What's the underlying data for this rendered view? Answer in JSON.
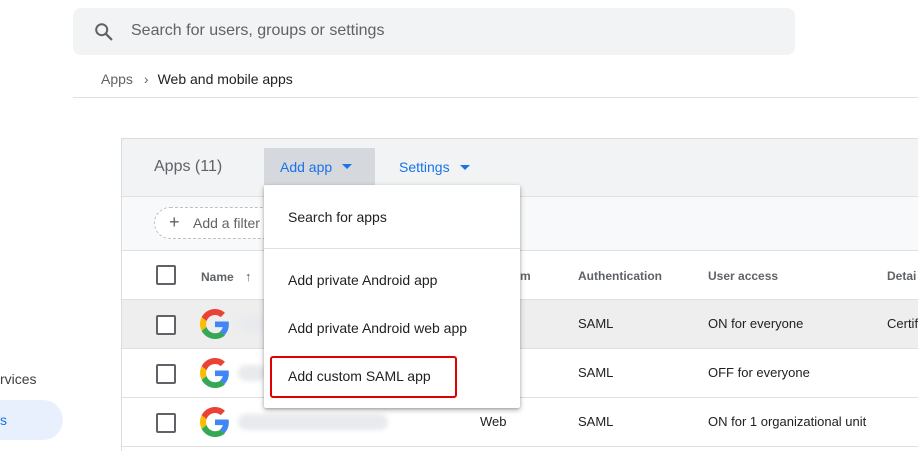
{
  "search": {
    "placeholder": "Search for users, groups or settings"
  },
  "breadcrumb": {
    "parent": "Apps",
    "separator": "›",
    "current": "Web and mobile apps"
  },
  "left_nav": {
    "services_label": "rvices",
    "active_label": "s"
  },
  "panel": {
    "title": "Apps (11)",
    "add_app_label": "Add app",
    "settings_label": "Settings",
    "filter_label": "Add a filter",
    "columns": {
      "name": "Name",
      "type": "m",
      "authentication": "Authentication",
      "user_access": "User access",
      "details": "Detai"
    },
    "rows": [
      {
        "type": "",
        "auth": "SAML",
        "access": "ON for everyone",
        "details": "Certif"
      },
      {
        "type": "",
        "auth": "SAML",
        "access": "OFF for everyone",
        "details": ""
      },
      {
        "type": "Web",
        "auth": "SAML",
        "access": "ON for 1 organizational unit",
        "details": ""
      }
    ]
  },
  "dropdown": {
    "items": [
      "Search for apps",
      "Add private Android app",
      "Add private Android web app",
      "Add custom SAML app"
    ]
  },
  "colors": {
    "accent": "#1a73e8",
    "highlight_box": "#e00000"
  }
}
